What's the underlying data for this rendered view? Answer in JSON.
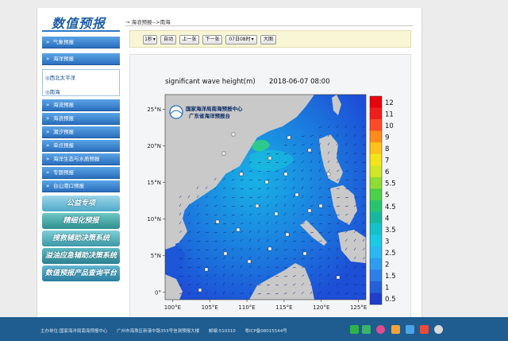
{
  "sidebar": {
    "brand": "数值预报",
    "items": [
      {
        "label": "气象预报"
      },
      {
        "label": "海洋预报"
      },
      {
        "label": "海流预报"
      },
      {
        "label": "海浪预报"
      },
      {
        "label": "潮汐预报"
      },
      {
        "label": "单点预报"
      },
      {
        "label": "海洋生态与水质预报"
      },
      {
        "label": "专题预报"
      },
      {
        "label": "台山港口预报"
      }
    ],
    "subitems": [
      {
        "label": "西北太平洋"
      },
      {
        "label": "南海"
      }
    ],
    "promos": [
      {
        "label": "公益专项"
      },
      {
        "label": "精细化预报"
      },
      {
        "label": "搜救辅助决策系统"
      },
      {
        "label": "溢油应急辅助决策系统"
      },
      {
        "label": "数值预报产品查询平台"
      }
    ]
  },
  "main": {
    "breadcrumb": "海浪预报-->南海",
    "toolbar": {
      "step_select": "1秒",
      "auto_label": "自动",
      "prev_label": "上一张",
      "next_label": "下一张",
      "time_select": "07日08时",
      "large_label": "大图"
    }
  },
  "chart_data": {
    "type": "heatmap",
    "title": "significant wave height(m)",
    "date": "2018-06-07 08:00",
    "institution_line1": "国家海洋局南海预报中心",
    "institution_line2": "广东省海洋预报台",
    "x_ticks": [
      "100°E",
      "105°E",
      "110°E",
      "115°E",
      "120°E",
      "125°E"
    ],
    "y_ticks": [
      "25°N",
      "20°N",
      "15°N",
      "10°N",
      "5°N",
      "0°"
    ],
    "xlim": [
      99,
      126
    ],
    "ylim": [
      -1,
      27
    ],
    "colorbar": {
      "labels": [
        "12",
        "11",
        "10",
        "9",
        "8",
        "7",
        "6",
        "5.5",
        "5",
        "4.5",
        "4",
        "3.5",
        "3",
        "2.5",
        "2",
        "1.5",
        "1",
        "0.5"
      ],
      "colors": [
        "#e8000b",
        "#f21e1e",
        "#ff4a2a",
        "#ff8c1a",
        "#ffc21a",
        "#f3e51a",
        "#cfe826",
        "#8fdc34",
        "#4ccf4a",
        "#27c46e",
        "#16b9a0",
        "#14c1cb",
        "#19c9e6",
        "#2ab8f0",
        "#2e9df0",
        "#2d7fe6",
        "#2660d8",
        "#1f3fcb"
      ]
    }
  },
  "footer": {
    "host": "主办单位:国家海洋局南海预报中心",
    "address": "广州市海珠区新港中路353号信测预报大楼",
    "postcode": "邮编:510310",
    "icp": "粤ICP备08015544号"
  },
  "colors": {
    "nav_blue": "#2a6fbd",
    "footer_blue": "#1f5c8f",
    "land": "#c9c9c9",
    "sea_low": "#1f49d6",
    "sea_mid": "#1aa6e6"
  }
}
